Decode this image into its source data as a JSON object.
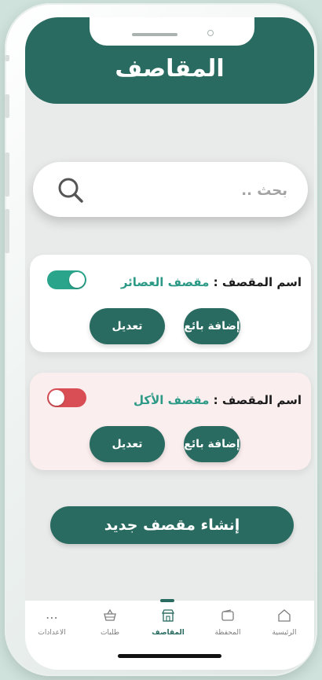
{
  "header": {
    "title": "المقاصف"
  },
  "search": {
    "placeholder": "بحث .."
  },
  "canteens": [
    {
      "label": "اسم المقصف :",
      "name": "مقصف العصائر",
      "enabled": true,
      "add_seller_label": "إضافة بائع",
      "edit_label": "تعديل"
    },
    {
      "label": "اسم المقصف :",
      "name": "مقصف الأكل",
      "enabled": false,
      "add_seller_label": "إضافة بائع",
      "edit_label": "تعديل"
    }
  ],
  "create_button": {
    "label": "إنشاء مقصف جديد"
  },
  "tabbar": {
    "items": [
      {
        "label": "الرئيسية",
        "icon": "home-icon"
      },
      {
        "label": "المحفظة",
        "icon": "wallet-icon"
      },
      {
        "label": "المقاصف",
        "icon": "store-icon",
        "active": true
      },
      {
        "label": "طلبات",
        "icon": "basket-icon"
      },
      {
        "label": "الاعدادات",
        "icon": "more-icon"
      }
    ]
  },
  "colors": {
    "primary": "#2a6b61",
    "accent_text": "#2c9a86",
    "toggle_on": "#2aa58c",
    "toggle_off": "#d94e55",
    "disabled_card_bg": "#fbeeee"
  }
}
